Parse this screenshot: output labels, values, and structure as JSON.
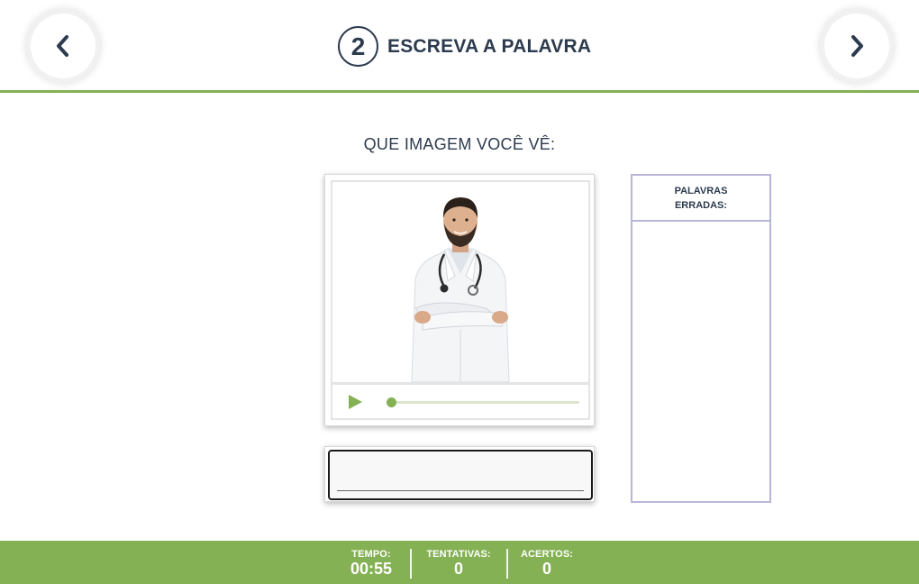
{
  "header": {
    "step_number": "2",
    "title": "ESCREVA A PALAVRA",
    "prev_icon": "chevron-left-icon",
    "next_icon": "chevron-right-icon"
  },
  "question": "QUE IMAGEM VOCÊ VÊ:",
  "media": {
    "image_subject": "doctor-in-white-coat-with-stethoscope",
    "play_icon": "play-icon",
    "audio_progress": 0.0
  },
  "answer": {
    "value": "",
    "placeholder": ""
  },
  "wrong_words": {
    "title": "PALAVRAS ERRADAS:",
    "items": []
  },
  "footer": {
    "time_label": "TEMPO:",
    "time_value": "00:55",
    "tries_label": "TENTATIVAS:",
    "tries_value": "0",
    "hits_label": "ACERTOS:",
    "hits_value": "0"
  },
  "colors": {
    "accent_green": "#84b153",
    "text_navy": "#2d3b4e",
    "panel_border": "#b8b6d8"
  }
}
